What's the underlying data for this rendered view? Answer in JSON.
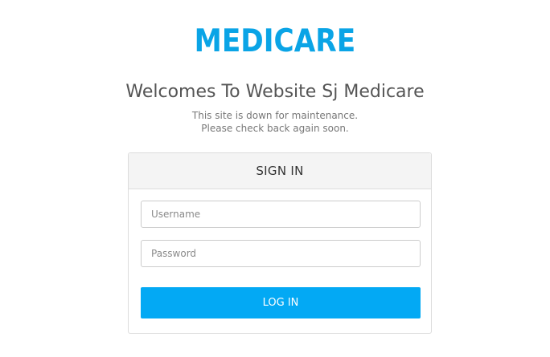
{
  "brand": {
    "logo_text": "MEDICARE"
  },
  "header": {
    "title": "Welcomes To Website Sj Medicare",
    "subtitle_line1": "This site is down for maintenance.",
    "subtitle_line2": "Please check back again soon."
  },
  "login": {
    "heading": "SIGN IN",
    "username_placeholder": "Username",
    "password_placeholder": "Password",
    "button_label": "LOG IN"
  },
  "colors": {
    "accent": "#03a9f4",
    "logo": "#0aa4e6",
    "text": "#555555",
    "panel_header_bg": "#f4f4f4"
  }
}
